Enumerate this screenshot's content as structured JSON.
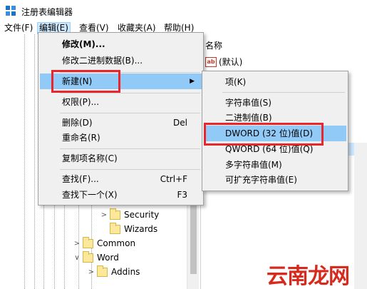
{
  "window": {
    "title": "注册表编辑器",
    "icon": "registry-editor-icon"
  },
  "menubar": [
    "文件(F)",
    "编辑(E)",
    "查看(V)",
    "收藏夹(A)",
    "帮助(H)"
  ],
  "right_pane": {
    "column_name": "名称",
    "default_value": "(默认)",
    "value_icon": "string-value-icon"
  },
  "tree": [
    {
      "label": "Security",
      "level": 3,
      "expander": "right"
    },
    {
      "label": "Wizards",
      "level": 3,
      "expander": "none"
    },
    {
      "label": "Common",
      "level": 2,
      "expander": "right"
    },
    {
      "label": "Word",
      "level": 2,
      "expander": "down"
    },
    {
      "label": "Addins",
      "level": 3,
      "expander": "right"
    }
  ],
  "edit_menu": {
    "modify": "修改(M)...",
    "modify_binary": "修改二进制数据(B)...",
    "new": "新建(N)",
    "permissions": "权限(P)...",
    "delete": "删除(D)",
    "delete_shortcut": "Del",
    "rename": "重命名(R)",
    "copy_key_name": "复制项名称(C)",
    "find": "查找(F)...",
    "find_shortcut": "Ctrl+F",
    "find_next": "查找下一个(X)",
    "find_next_shortcut": "F3"
  },
  "new_submenu": {
    "key": "项(K)",
    "string_value": "字符串值(S)",
    "binary_value": "二进制值(B)",
    "dword_value": "DWORD (32 位)值(D)",
    "qword_value": "QWORD (64 位)值(Q)",
    "multi_string_value": "多字符串值(M)",
    "expandable_string_value": "可扩充字符串值(E)"
  },
  "watermark": "云南龙网",
  "colors": {
    "highlight": "#91c9f7",
    "annotation_red": "#e8262c",
    "menubar_active": "#cce8ff"
  }
}
